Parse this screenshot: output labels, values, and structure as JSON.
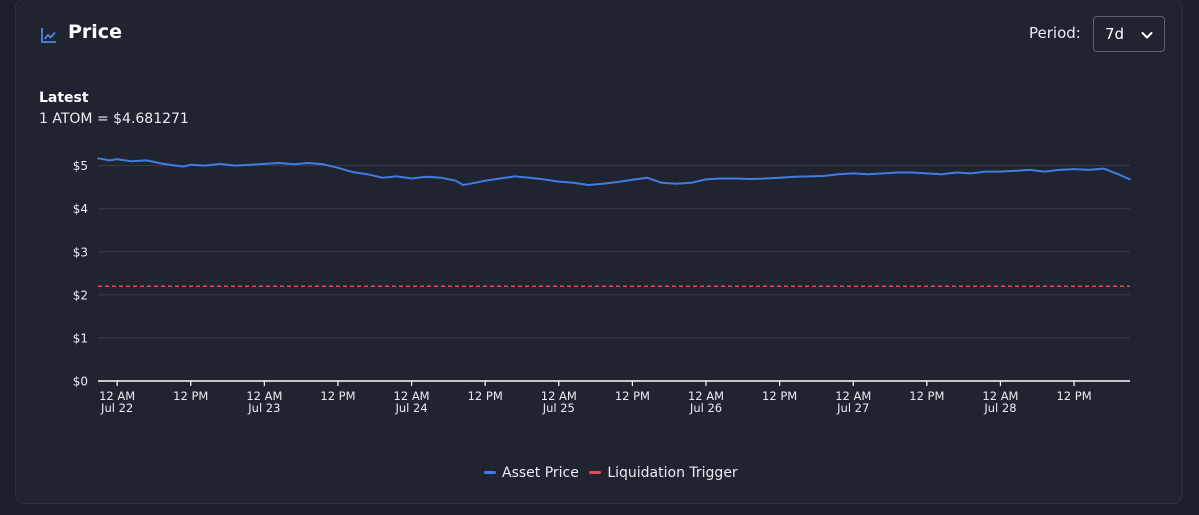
{
  "header": {
    "title": "Price",
    "title_icon": "line-chart-icon",
    "period_label": "Period:",
    "period_value": "7d",
    "dropdown_icon": "chevron-down-icon"
  },
  "latest": {
    "label": "Latest",
    "value": "1 ATOM = $4.681271"
  },
  "colors": {
    "asset_price": "#3f7ddf",
    "liquidation": "#e5484d",
    "grid": "#373c48",
    "axis": "#e9ecf1"
  },
  "chart_data": {
    "type": "line",
    "x_unit": "days since 12 AM Jul 22",
    "xlim": [
      -0.13,
      6.88
    ],
    "ylim": [
      0,
      5.2
    ],
    "y_ticks": [
      0,
      1,
      2,
      3,
      4,
      5
    ],
    "y_tick_labels": [
      "$0",
      "$1",
      "$2",
      "$3",
      "$4",
      "$5"
    ],
    "x_ticks": [
      {
        "x": 0.0,
        "line1": "12 AM",
        "line2": "Jul 22"
      },
      {
        "x": 0.5,
        "line1": "12 PM",
        "line2": ""
      },
      {
        "x": 1.0,
        "line1": "12 AM",
        "line2": "Jul 23"
      },
      {
        "x": 1.5,
        "line1": "12 PM",
        "line2": ""
      },
      {
        "x": 2.0,
        "line1": "12 AM",
        "line2": "Jul 24"
      },
      {
        "x": 2.5,
        "line1": "12 PM",
        "line2": ""
      },
      {
        "x": 3.0,
        "line1": "12 AM",
        "line2": "Jul 25"
      },
      {
        "x": 3.5,
        "line1": "12 PM",
        "line2": ""
      },
      {
        "x": 4.0,
        "line1": "12 AM",
        "line2": "Jul 26"
      },
      {
        "x": 4.5,
        "line1": "12 PM",
        "line2": ""
      },
      {
        "x": 5.0,
        "line1": "12 AM",
        "line2": "Jul 27"
      },
      {
        "x": 5.5,
        "line1": "12 PM",
        "line2": ""
      },
      {
        "x": 6.0,
        "line1": "12 AM",
        "line2": "Jul 28"
      },
      {
        "x": 6.5,
        "line1": "12 PM",
        "line2": ""
      }
    ],
    "series": [
      {
        "name": "Asset Price",
        "style": "solid",
        "x": [
          -0.13,
          -0.05,
          0.0,
          0.1,
          0.2,
          0.3,
          0.4,
          0.45,
          0.5,
          0.6,
          0.7,
          0.8,
          0.9,
          1.0,
          1.1,
          1.2,
          1.3,
          1.4,
          1.5,
          1.6,
          1.7,
          1.8,
          1.9,
          2.0,
          2.1,
          2.2,
          2.3,
          2.35,
          2.4,
          2.5,
          2.6,
          2.7,
          2.8,
          2.9,
          3.0,
          3.1,
          3.2,
          3.3,
          3.4,
          3.5,
          3.6,
          3.7,
          3.8,
          3.9,
          4.0,
          4.1,
          4.2,
          4.3,
          4.4,
          4.5,
          4.6,
          4.7,
          4.8,
          4.9,
          5.0,
          5.1,
          5.2,
          5.3,
          5.4,
          5.5,
          5.6,
          5.7,
          5.8,
          5.9,
          6.0,
          6.1,
          6.2,
          6.3,
          6.4,
          6.5,
          6.6,
          6.7,
          6.8,
          6.88
        ],
        "y": [
          5.17,
          5.12,
          5.15,
          5.1,
          5.12,
          5.05,
          5.0,
          4.98,
          5.02,
          5.0,
          5.04,
          5.0,
          5.02,
          5.04,
          5.06,
          5.03,
          5.06,
          5.03,
          4.95,
          4.85,
          4.8,
          4.72,
          4.75,
          4.7,
          4.74,
          4.72,
          4.65,
          4.55,
          4.58,
          4.65,
          4.7,
          4.75,
          4.72,
          4.68,
          4.63,
          4.6,
          4.55,
          4.58,
          4.62,
          4.67,
          4.72,
          4.6,
          4.58,
          4.6,
          4.68,
          4.7,
          4.7,
          4.69,
          4.7,
          4.72,
          4.74,
          4.75,
          4.76,
          4.8,
          4.82,
          4.8,
          4.82,
          4.84,
          4.84,
          4.82,
          4.8,
          4.84,
          4.82,
          4.86,
          4.86,
          4.88,
          4.9,
          4.86,
          4.9,
          4.92,
          4.9,
          4.93,
          4.8,
          4.68
        ]
      },
      {
        "name": "Liquidation Trigger",
        "style": "dashed",
        "x": [
          -0.13,
          6.88
        ],
        "y": [
          2.2,
          2.2
        ]
      }
    ]
  }
}
